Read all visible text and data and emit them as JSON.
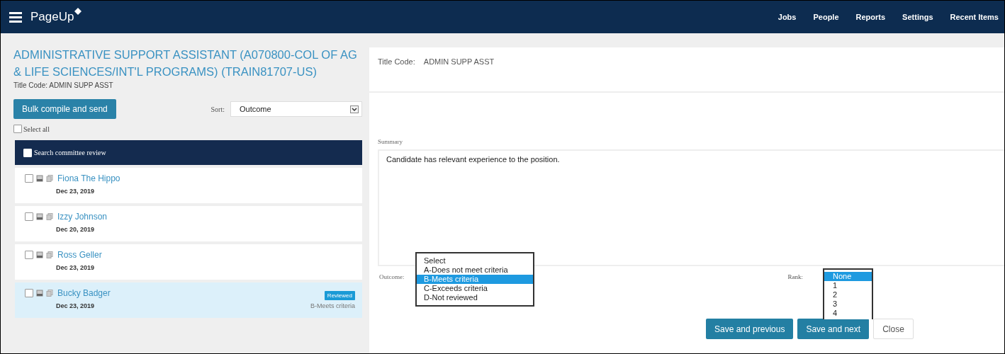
{
  "header": {
    "brand": "PageUp",
    "nav": [
      "Jobs",
      "People",
      "Reports",
      "Settings",
      "Recent Items"
    ]
  },
  "left": {
    "title": "ADMINISTRATIVE SUPPORT ASSISTANT (A070800-COL OF AG & LIFE SCIENCES/INT'L PROGRAMS) (TRAIN81707-US)",
    "title_code": "Title Code: ADMIN SUPP ASST",
    "bulk_button": "Bulk compile and send",
    "sort": {
      "label": "Sort:",
      "value": "Outcome"
    },
    "select_all": {
      "label": "Select all",
      "checked": false
    },
    "list_header": {
      "label": "Search committee review",
      "checked": false
    },
    "candidates": [
      {
        "name": "Fiona The Hippo",
        "date": "Dec 23, 2019",
        "checked": false,
        "selected": false
      },
      {
        "name": "Izzy Johnson",
        "date": "Dec 20, 2019",
        "checked": false,
        "selected": false
      },
      {
        "name": "Ross Geller",
        "date": "Dec 23, 2019",
        "checked": false,
        "selected": false
      },
      {
        "name": "Bucky Badger",
        "date": "Dec 23, 2019",
        "checked": false,
        "selected": true,
        "badge": "Reviewed",
        "outcome": "B-Meets criteria"
      }
    ]
  },
  "detail": {
    "title_code_label": "Title Code:",
    "title_code_value": "ADMIN SUPP ASST",
    "summary_label": "Summary",
    "summary": "Candidate has relevant experience to the position.",
    "outcome": {
      "label": "Outcome:",
      "options": [
        {
          "label": "Select",
          "selected": false
        },
        {
          "label": "A-Does not meet criteria",
          "selected": false
        },
        {
          "label": "B-Meets criteria",
          "selected": true
        },
        {
          "label": "C-Exceeds criteria",
          "selected": false
        },
        {
          "label": "D-Not reviewed",
          "selected": false
        }
      ]
    },
    "rank": {
      "label": "Rank:",
      "options": [
        {
          "label": "None",
          "selected": true
        },
        {
          "label": "1",
          "selected": false
        },
        {
          "label": "2",
          "selected": false
        },
        {
          "label": "3",
          "selected": false
        },
        {
          "label": "4",
          "selected": false
        }
      ]
    },
    "buttons": [
      {
        "label": "Save and previous",
        "kind": "primary"
      },
      {
        "label": "Save and next",
        "kind": "primary"
      },
      {
        "label": "Close",
        "kind": "secondary"
      }
    ]
  }
}
